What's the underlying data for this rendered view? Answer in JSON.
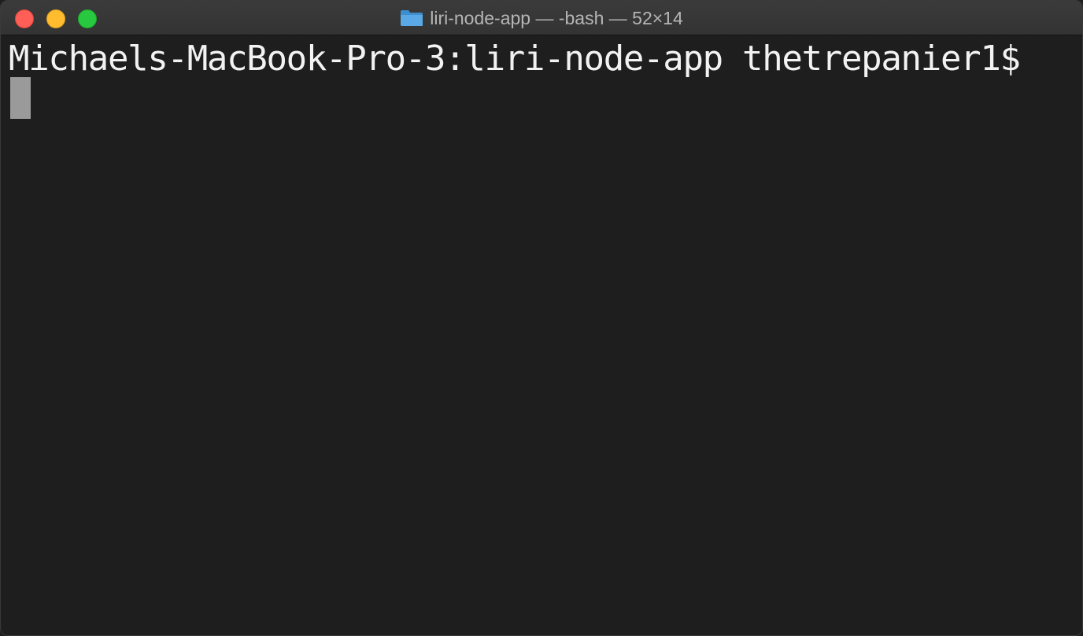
{
  "window": {
    "title": "liri-node-app — -bash — 52×14",
    "title_icon": "folder-icon",
    "traffic_lights": {
      "close_color": "#ff5f57",
      "minimize_color": "#febc2e",
      "maximize_color": "#28c840"
    }
  },
  "terminal": {
    "prompt": "Michaels-MacBook-Pro-3:liri-node-app thetrepanier1$",
    "background": "#1e1e1e",
    "text_color": "#f2f2f2",
    "cursor_color": "#9a9a9a"
  }
}
